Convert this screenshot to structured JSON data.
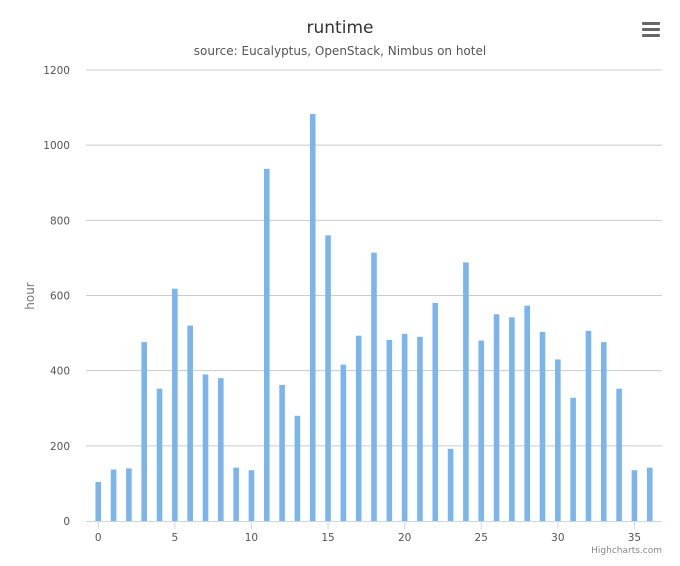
{
  "credits": "Highcharts.com",
  "menu": {
    "icon": "hamburger-menu-icon"
  },
  "colors": {
    "bar": "#7cb5ec",
    "grid": "#cccccc",
    "axis": "#ccd6eb",
    "menu": "#666666"
  },
  "chart_data": {
    "type": "bar",
    "title": "runtime",
    "subtitle": "source: Eucalyptus, OpenStack, Nimbus on hotel",
    "xlabel": "",
    "ylabel": "hour",
    "x": [
      0,
      1,
      2,
      3,
      4,
      5,
      6,
      7,
      8,
      9,
      10,
      11,
      12,
      13,
      14,
      15,
      16,
      17,
      18,
      19,
      20,
      21,
      22,
      23,
      24,
      25,
      26,
      27,
      28,
      29,
      30,
      31,
      32,
      33,
      34,
      35,
      36
    ],
    "values": [
      104,
      137,
      140,
      476,
      352,
      618,
      520,
      390,
      380,
      142,
      135,
      937,
      362,
      280,
      1083,
      760,
      416,
      493,
      714,
      482,
      498,
      490,
      580,
      192,
      688,
      480,
      550,
      542,
      573,
      503,
      430,
      328,
      506,
      476,
      352,
      135,
      142
    ],
    "ylim": [
      0,
      1200
    ],
    "yticks": [
      0,
      200,
      400,
      600,
      800,
      1000,
      1200
    ],
    "xticks": [
      0,
      5,
      10,
      15,
      20,
      25,
      30,
      35
    ],
    "grid": true,
    "legend": false
  }
}
